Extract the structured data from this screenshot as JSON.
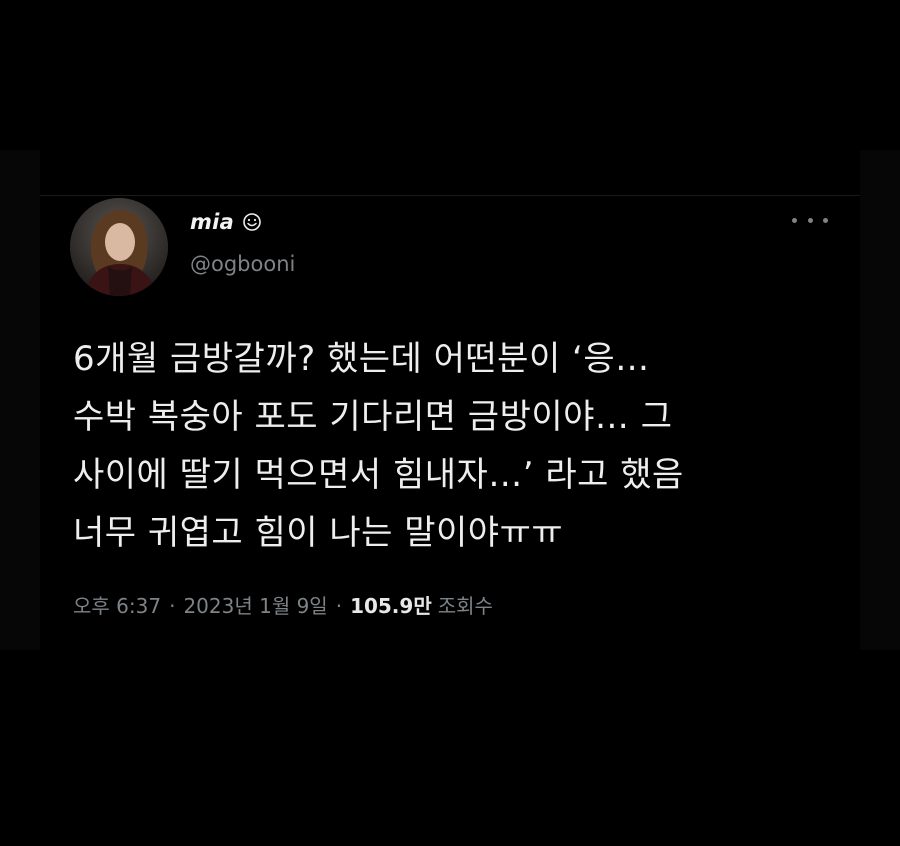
{
  "tweet": {
    "author": {
      "display_name": "mia",
      "name_emoji_icon": "smiling-face-icon",
      "handle": "@ogbooni",
      "avatar": "profile-photo"
    },
    "more_icon": "more-horizontal-icon",
    "text_lines": [
      "6개월 금방갈까? 했는데 어떤분이 ‘응…",
      "수박 복숭아 포도 기다리면 금방이야… 그",
      "사이에 딸기 먹으면서 힘내자…’ 라고 했음",
      "너무 귀엽고 힘이 나는 말이야ㅠㅠ"
    ],
    "meta": {
      "time": "오후 6:37",
      "separator": "·",
      "date": "2023년 1월 9일",
      "views_count": "105.9만",
      "views_label": "조회수"
    }
  },
  "colors": {
    "background": "#000000",
    "primary_text": "#eeeeee",
    "secondary_text": "#7d8387"
  }
}
